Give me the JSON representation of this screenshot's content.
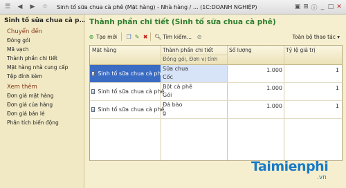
{
  "window": {
    "title": "Sinh tố sữa chua cà phê (Mặt hàng) - Nhà hàng / ... (1C:DOANH NGHIỆP)"
  },
  "left_panel": {
    "header": "Sinh tố sữa chua cà p...",
    "section1": "Chuyển đến",
    "goto_items": [
      "Đóng gói",
      "Mã vạch",
      "Thành phần chi tiết",
      "Mặt hàng nhà cung cấp",
      "Tệp đính kèm"
    ],
    "section2": "Xem thêm",
    "more_items": [
      "Đơn giá mặt hàng",
      "Đơn giá của hàng",
      "Đơn giá bán lẻ",
      "Phân tích biến động"
    ]
  },
  "main": {
    "title": "Thành phần chi tiết (Sinh tố sữa chua cà phê)",
    "toolbar": {
      "new_label": "Tạo mới",
      "find_label": "Tìm kiếm...",
      "all_actions": "Toàn bộ thao tác"
    },
    "table": {
      "col_item": "Mặt hàng",
      "col_comp": "Thành phần chi tiết",
      "col_comp_sub": "Đóng gói, Đơn vị tính",
      "col_qty": "Số lượng",
      "col_ratio": "Tỷ lệ giá trị",
      "rows": [
        {
          "item": "Sinh tố sữa chua cà phê",
          "comp": "Sữa chua",
          "unit": "Cốc",
          "qty": "1.000",
          "ratio": "1"
        },
        {
          "item": "Sinh tố sữa chua cà phê",
          "comp": "Bột cà phê",
          "unit": "Gói",
          "qty": "1.000",
          "ratio": "1"
        },
        {
          "item": "Sinh tố sữa chua cà phê",
          "comp": "Đá bào",
          "unit": "g",
          "qty": "1.000",
          "ratio": "1"
        }
      ]
    }
  },
  "watermark": {
    "text": "Taimienphi",
    "sub": ".vn"
  }
}
